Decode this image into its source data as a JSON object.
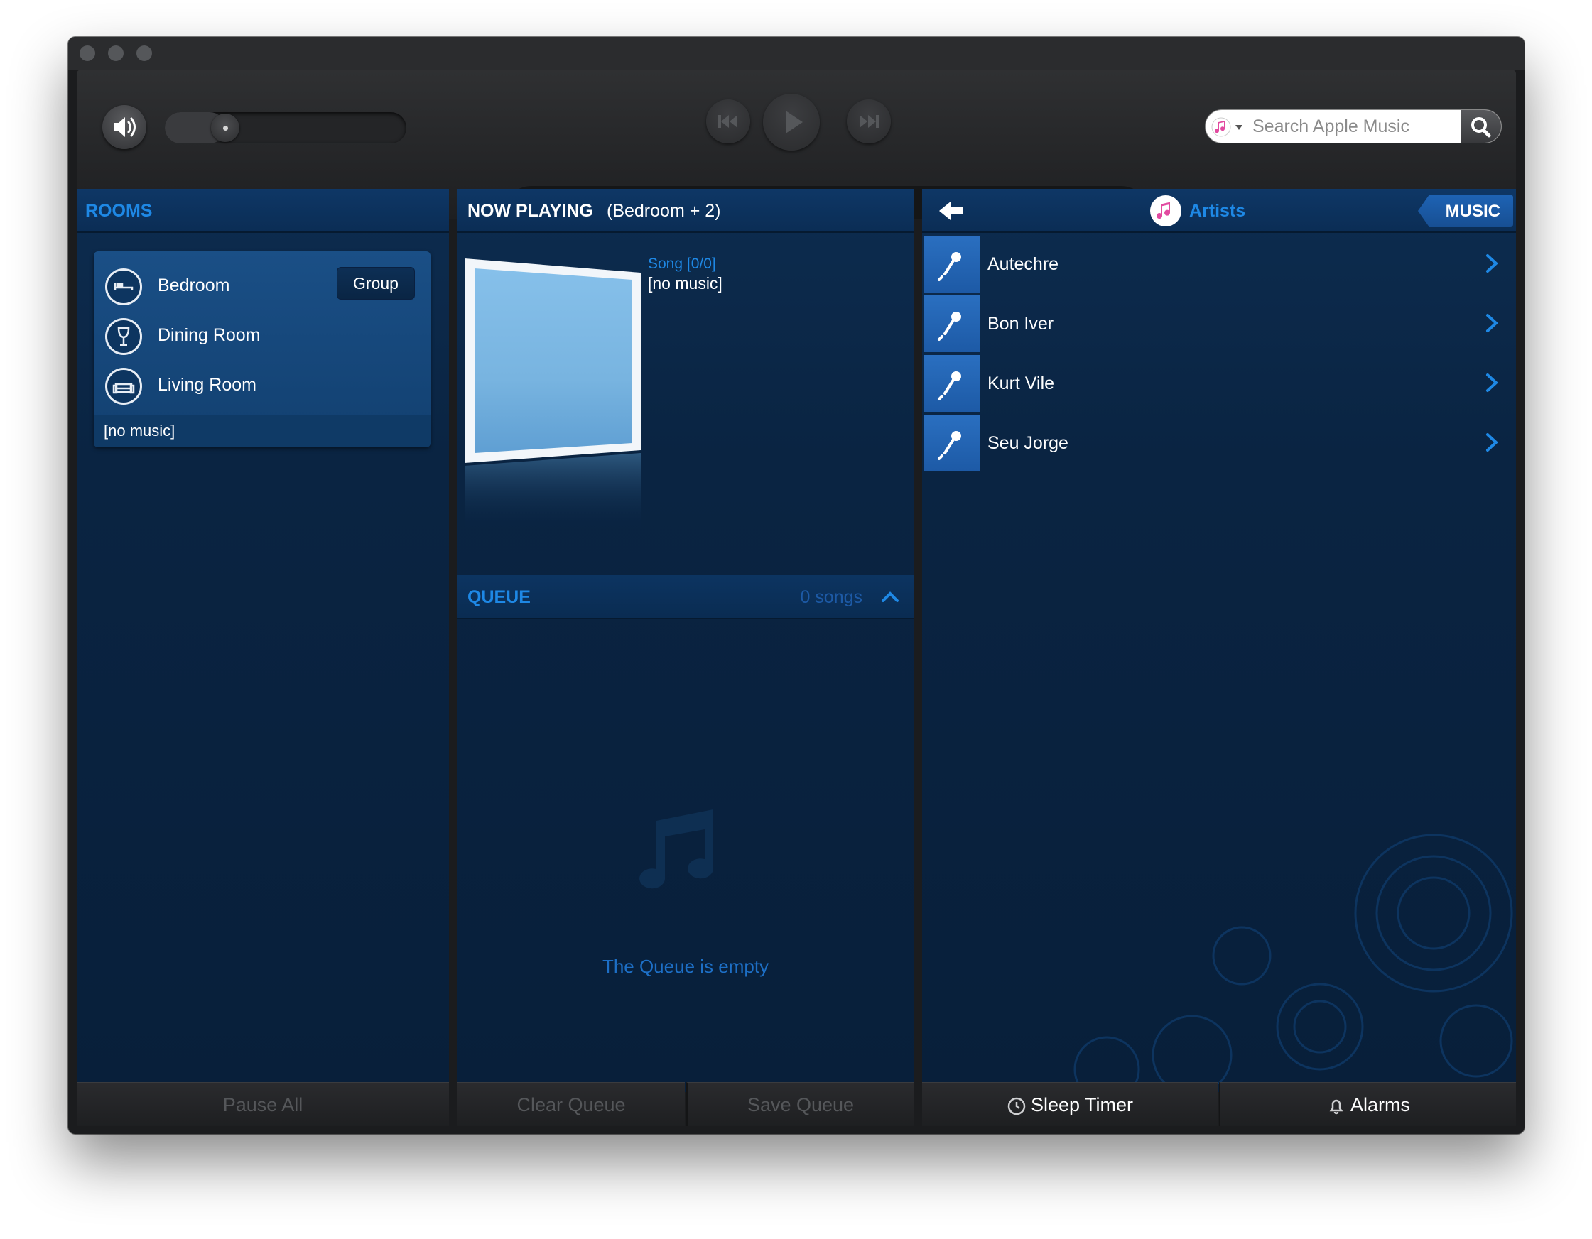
{
  "toolbar": {
    "search_placeholder": "Search Apple Music",
    "volume_level": 0.25
  },
  "rooms": {
    "header": "ROOMS",
    "group_label": "Group",
    "items": [
      {
        "label": "Bedroom",
        "icon": "bed-icon"
      },
      {
        "label": "Dining Room",
        "icon": "wine-glass-icon"
      },
      {
        "label": "Living Room",
        "icon": "sofa-icon"
      }
    ],
    "status": "[no music]",
    "footer_button": "Pause All"
  },
  "now_playing": {
    "header_title": "NOW PLAYING",
    "header_subtitle": "(Bedroom + 2)",
    "song_label": "Song [0/0]",
    "track_info": "[no music]"
  },
  "queue": {
    "header": "QUEUE",
    "count": "0 songs",
    "empty_message": "The Queue is empty",
    "clear_button": "Clear Queue",
    "save_button": "Save Queue"
  },
  "music": {
    "title": "Artists",
    "badge": "MUSIC",
    "artists": [
      "Autechre",
      "Bon Iver",
      "Kurt Vile",
      "Seu Jorge"
    ],
    "sleep_timer": "Sleep Timer",
    "alarms": "Alarms"
  },
  "colors": {
    "accent_blue": "#1e88e5",
    "panel_bg": "#0a2442",
    "header_bg": "#0e3766",
    "artist_tile": "#2a6fc0"
  }
}
